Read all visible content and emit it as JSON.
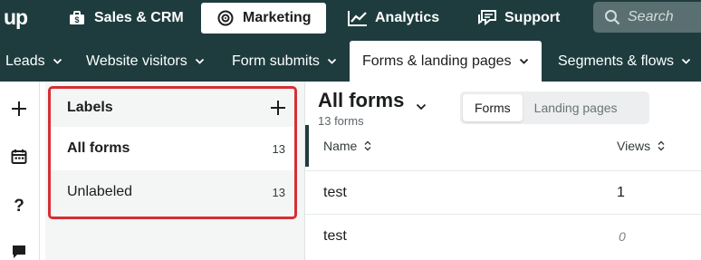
{
  "app": {
    "logo": "up"
  },
  "top_nav": {
    "items": [
      {
        "label": "Sales & CRM",
        "icon": "briefcase-icon"
      },
      {
        "label": "Marketing",
        "icon": "target-icon",
        "active": true
      },
      {
        "label": "Analytics",
        "icon": "chart-icon"
      },
      {
        "label": "Support",
        "icon": "chat-icon"
      }
    ],
    "search_placeholder": "Search"
  },
  "sub_nav": {
    "items": [
      {
        "label": "Leads"
      },
      {
        "label": "Website visitors"
      },
      {
        "label": "Form submits"
      },
      {
        "label": "Forms & landing pages",
        "active": true
      },
      {
        "label": "Segments & flows"
      }
    ]
  },
  "rail": {
    "icons": [
      "plus-icon",
      "calendar-icon",
      "help-icon",
      "chat-icon"
    ]
  },
  "labels_panel": {
    "title": "Labels",
    "items": [
      {
        "name": "All forms",
        "count": "13",
        "selected": true
      },
      {
        "name": "Unlabeled",
        "count": "13",
        "selected": false
      }
    ]
  },
  "main": {
    "title": "All forms",
    "subtitle": "13 forms",
    "toggle": {
      "options": [
        "Forms",
        "Landing pages"
      ],
      "selected": "Forms"
    },
    "table": {
      "columns": [
        "Name",
        "Views"
      ],
      "rows": [
        {
          "name": "test",
          "views": "1"
        },
        {
          "name": "test",
          "views": "0"
        }
      ]
    }
  },
  "colors": {
    "nav_bg": "#1e3c3e",
    "highlight_border": "#d62f33",
    "panel_bg": "#f4f5f5"
  }
}
